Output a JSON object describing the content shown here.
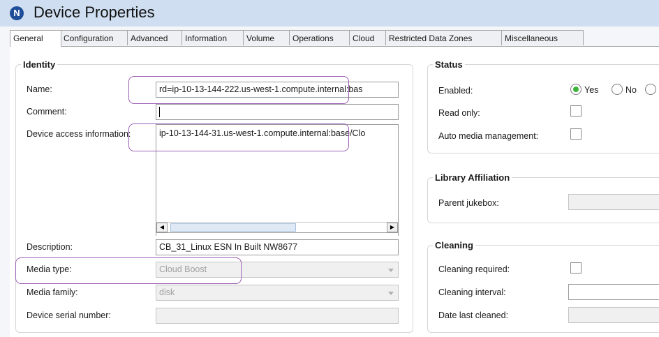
{
  "window": {
    "title": "Device Properties",
    "icon": "nw-logo-icon",
    "icon_glyph": "N"
  },
  "tabs": [
    "General",
    "Configuration",
    "Advanced",
    "Information",
    "Volume",
    "Operations",
    "Cloud",
    "Restricted Data Zones",
    "Miscellaneous"
  ],
  "active_tab": "General",
  "identity": {
    "title": "Identity",
    "name_label": "Name:",
    "name_value": "rd=ip-10-13-144-222.us-west-1.compute.internal:bas",
    "comment_label": "Comment:",
    "comment_value": "",
    "access_label": "Device access information:",
    "access_value": "ip-10-13-144-31.us-west-1.compute.internal:base/Clo",
    "description_label": "Description:",
    "description_value": "CB_31_Linux ESN In Built NW8677",
    "media_type_label": "Media type:",
    "media_type_value": "Cloud Boost",
    "media_family_label": "Media family:",
    "media_family_value": "disk",
    "serial_label": "Device serial number:",
    "serial_value": ""
  },
  "status": {
    "title": "Status",
    "enabled_label": "Enabled:",
    "yes_label": "Yes",
    "no_label": "No",
    "enabled_value": "Yes",
    "readonly_label": "Read only:",
    "readonly_checked": false,
    "auto_media_label": "Auto media management:",
    "auto_media_checked": false
  },
  "library": {
    "title": "Library Affiliation",
    "parent_label": "Parent jukebox:",
    "parent_value": ""
  },
  "cleaning": {
    "title": "Cleaning",
    "required_label": "Cleaning required:",
    "required_checked": false,
    "interval_label": "Cleaning interval:",
    "interval_value": "",
    "last_label": "Date last cleaned:",
    "last_value": ""
  },
  "colors": {
    "title_bar": "#cfdff1",
    "highlight": "#9c5fb4",
    "radio_selected": "#3db33d"
  }
}
